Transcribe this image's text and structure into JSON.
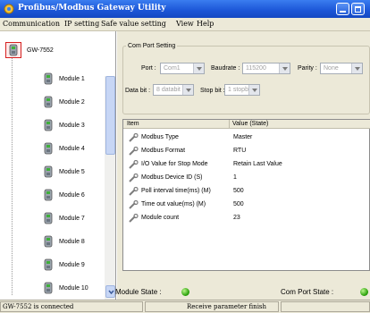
{
  "window": {
    "title": "Profibus/Modbus Gateway Utility"
  },
  "menu": [
    "Communication",
    "IP setting",
    "Safe value setting",
    "View",
    "Help"
  ],
  "tree": {
    "root": "GW-7552",
    "modules": [
      "Module 1",
      "Module 2",
      "Module 3",
      "Module 4",
      "Module 5",
      "Module 6",
      "Module 7",
      "Module 8",
      "Module 9",
      "Module 10"
    ]
  },
  "com_port": {
    "legend": "Com Port Setting",
    "port_label": "Port :",
    "port_value": "Com1",
    "baudrate_label": "Baudrate :",
    "baudrate_value": "115200",
    "parity_label": "Parity :",
    "parity_value": "None",
    "databit_label": "Data bit :",
    "databit_value": "8 databit",
    "stopbit_label": "Stop bit :",
    "stopbit_value": "1 stopbit"
  },
  "table": {
    "headers": [
      "Item",
      "Value (State)"
    ],
    "rows": [
      {
        "item": "Modbus Type",
        "value": "Master"
      },
      {
        "item": "Modbus Format",
        "value": "RTU"
      },
      {
        "item": "I/O Value for Stop Mode",
        "value": "Retain Last Value"
      },
      {
        "item": "Modbus Device ID (S)",
        "value": "1"
      },
      {
        "item": "Poll interval time(ms) (M)",
        "value": "500"
      },
      {
        "item": "Time out value(ms) (M)",
        "value": "500"
      },
      {
        "item": "Module count",
        "value": "23"
      }
    ]
  },
  "status": {
    "module_state_label": "Module  State :",
    "module_state_color": "#2aa10a",
    "com_port_state_label": "Com Port State :",
    "com_port_state_color": "#2aa10a"
  },
  "statusbar": {
    "left": "GW-7552 is connected",
    "center": "Receive parameter finish"
  },
  "colors": {
    "titlebar": "#1b55d6",
    "panel": "#ece9d8",
    "led_on": "#2aa10a"
  }
}
